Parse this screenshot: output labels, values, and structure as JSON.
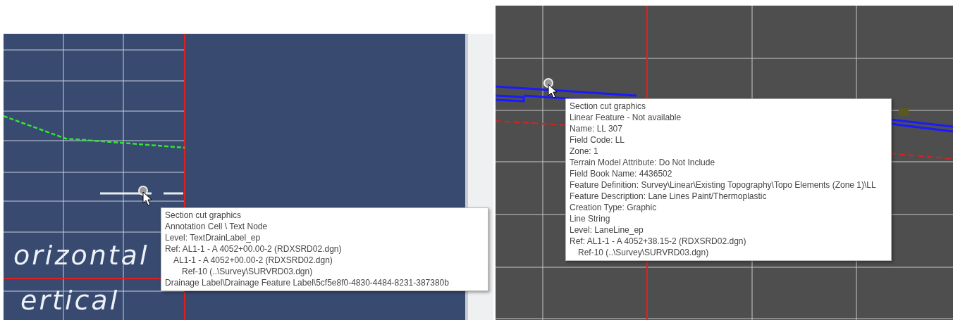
{
  "panels": [
    {
      "kind": "blue",
      "axis_labels": [
        "orizontal",
        "ertical"
      ],
      "tooltip": {
        "lines": [
          {
            "text": "Section cut graphics"
          },
          {
            "text": "Annotation Cell \\ Text Node"
          },
          {
            "text": "Level: TextDrainLabel_ep"
          },
          {
            "text": "Ref: AL1-1 - A 4052+00.00-2 (RDXSRD02.dgn)",
            "children": [
              {
                "text": "AL1-1 - A 4052+00.00-2 (RDXSRD02.dgn)",
                "children": [
                  {
                    "text": "Ref-10 (..\\Survey\\SURVRD03.dgn)"
                  }
                ]
              }
            ]
          },
          {
            "text": "Drainage Label\\Drainage Feature Label\\5cf5e8f0-4830-4484-8231-387380b"
          }
        ]
      }
    },
    {
      "kind": "dark",
      "tooltip": {
        "lines": [
          {
            "text": "Section cut graphics"
          },
          {
            "text": "Linear Feature - Not available"
          },
          {
            "text": "Name: LL 307"
          },
          {
            "text": "Field Code: LL"
          },
          {
            "text": "Zone: 1"
          },
          {
            "text": "Terrain Model Attribute: Do Not Include"
          },
          {
            "text": "Field Book Name: 4436502"
          },
          {
            "text": "Feature Definition: Survey\\Linear\\Existing Topography\\Topo Elements (Zone 1)\\LL"
          },
          {
            "text": "Feature Description: Lane Lines Paint/Thermoplastic"
          },
          {
            "text": "Creation Type: Graphic"
          },
          {
            "text": "Line String"
          },
          {
            "text": "Level: LaneLine_ep"
          },
          {
            "text": "Ref: AL1-1 - A 4052+38.15-2 (RDXSRD02.dgn)",
            "children": [
              {
                "text": "Ref-10 (..\\Survey\\SURVRD03.dgn)"
              }
            ]
          }
        ]
      }
    }
  ]
}
